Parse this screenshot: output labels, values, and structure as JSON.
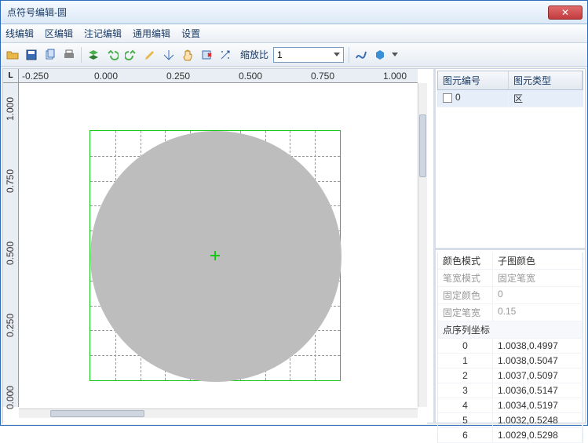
{
  "window": {
    "title": "点符号编辑-圆",
    "close_icon": "✕"
  },
  "menu": {
    "items": [
      "线编辑",
      "区编辑",
      "注记编辑",
      "通用编辑",
      "设置"
    ]
  },
  "toolbar": {
    "zoom_label": "缩放比",
    "zoom_value": "1"
  },
  "ruler_corner": "L",
  "ruler_h": [
    "-0.250",
    "0.000",
    "0.250",
    "0.500",
    "0.750",
    "1.000"
  ],
  "ruler_v": [
    "1.000",
    "0.750",
    "0.500",
    "0.250",
    "0.000"
  ],
  "elements_table": {
    "headers": [
      "图元编号",
      "图元类型"
    ],
    "rows": [
      {
        "id": "0",
        "type": "区",
        "checked": false,
        "selected": true
      }
    ]
  },
  "props": {
    "rows": [
      {
        "label": "颜色模式",
        "value": "子图颜色",
        "dim": false
      },
      {
        "label": "笔宽模式",
        "value": "固定笔宽",
        "dim": true
      },
      {
        "label": "固定颜色",
        "value": "0",
        "dim": true
      },
      {
        "label": "固定笔宽",
        "value": "0.15",
        "dim": true
      }
    ],
    "coords_header": "点序列坐标",
    "coords": [
      {
        "idx": "0",
        "val": "1.0038,0.4997"
      },
      {
        "idx": "1",
        "val": "1.0038,0.5047"
      },
      {
        "idx": "2",
        "val": "1.0037,0.5097"
      },
      {
        "idx": "3",
        "val": "1.0036,0.5147"
      },
      {
        "idx": "4",
        "val": "1.0034,0.5197"
      },
      {
        "idx": "5",
        "val": "1.0032,0.5248"
      },
      {
        "idx": "6",
        "val": "1.0029,0.5298"
      }
    ]
  }
}
